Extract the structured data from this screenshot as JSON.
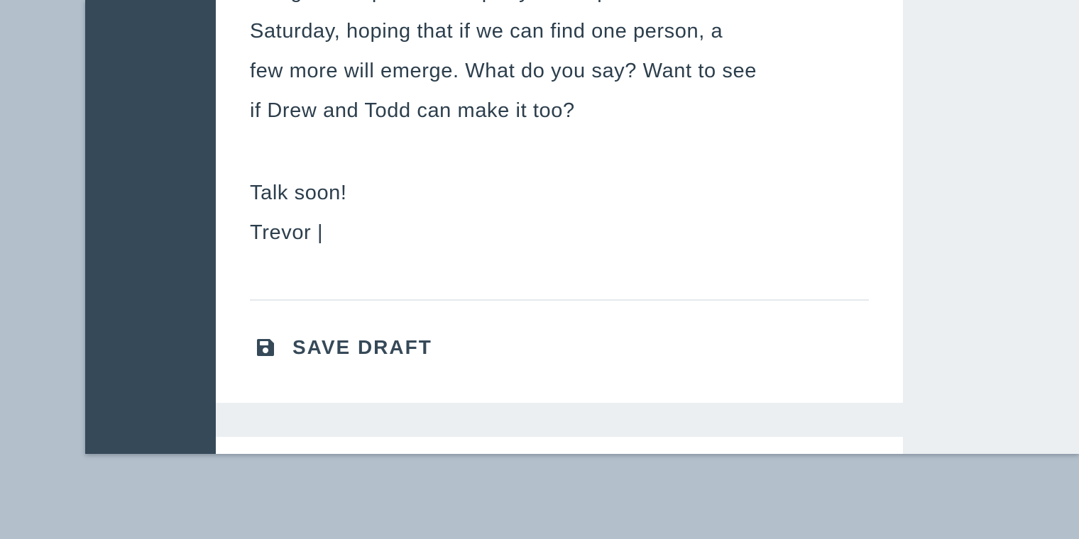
{
  "message": {
    "paragraph_lines": [
      "doing a little phone-tree party at her place next",
      "Saturday, hoping that if we can find one person, a",
      "few more will emerge. What do you say? Want to see",
      "if Drew and Todd can make it too?"
    ],
    "closing": "Talk soon!",
    "signature": "Trevor",
    "cursor": "|"
  },
  "actions": {
    "save_draft_label": "SAVE DRAFT",
    "save_icon": "floppy-disk-icon"
  },
  "colors": {
    "sidebar": "#364958",
    "background": "#ebeff2",
    "card": "#ffffff",
    "text": "#2c3e4c",
    "outer": "#b3bfcb"
  }
}
